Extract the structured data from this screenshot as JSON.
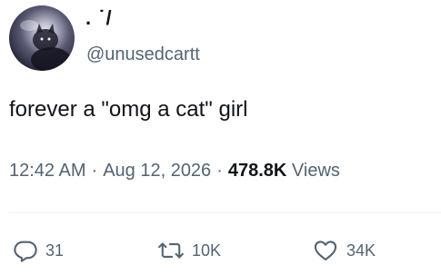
{
  "tweet": {
    "display_name": ". ˙/",
    "handle": "@unusedcartt",
    "text": "forever a \"omg a cat\" girl",
    "time": "12:42 AM",
    "date": "Aug 12, 2026",
    "views_count": "478.8K",
    "views_label": "Views",
    "separator": "·"
  },
  "actions": {
    "replies": "31",
    "retweets": "10K",
    "likes": "34K"
  },
  "icons": {
    "reply": "reply-icon",
    "retweet": "retweet-icon",
    "like": "heart-icon"
  },
  "colors": {
    "text": "#0f1419",
    "secondary": "#536471",
    "divider": "#eff3f4"
  }
}
